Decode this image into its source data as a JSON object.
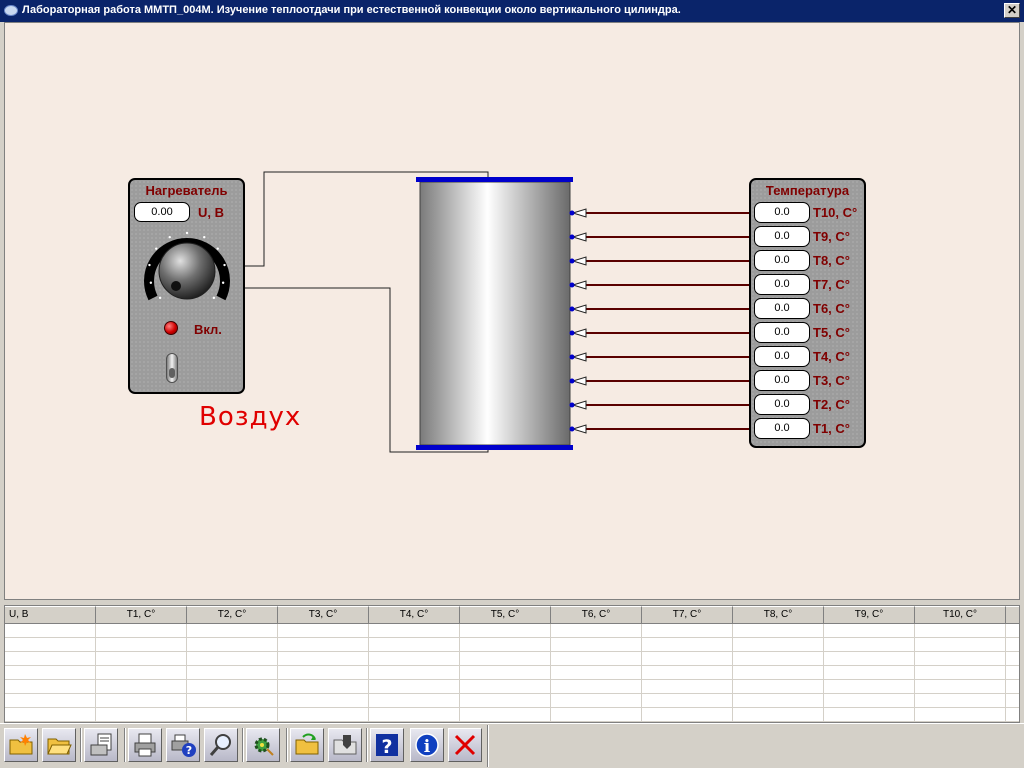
{
  "window": {
    "title": "Лабораторная работа ММТП_004М. Изучение теплоотдачи при естественной конвекции около вертикального цилиндра.",
    "close_label": "✕"
  },
  "heater": {
    "title": "Нагреватель",
    "voltage_value": "0.00",
    "voltage_label": "U, B",
    "power_label": "Вкл.",
    "led_color": "#d00000"
  },
  "environment_label": "Воздух",
  "temperature_panel": {
    "title": "Температура",
    "sensors": [
      {
        "label": "T10, C°",
        "value": "0.0"
      },
      {
        "label": "T9, C°",
        "value": "0.0"
      },
      {
        "label": "T8, C°",
        "value": "0.0"
      },
      {
        "label": "T7, C°",
        "value": "0.0"
      },
      {
        "label": "T6, C°",
        "value": "0.0"
      },
      {
        "label": "T5, C°",
        "value": "0.0"
      },
      {
        "label": "T4, C°",
        "value": "0.0"
      },
      {
        "label": "T3, C°",
        "value": "0.0"
      },
      {
        "label": "T2, C°",
        "value": "0.0"
      },
      {
        "label": "T1, C°",
        "value": "0.0"
      }
    ]
  },
  "table": {
    "columns": [
      "U, B",
      "T1, C°",
      "T2, C°",
      "T3, C°",
      "T4, C°",
      "T5, C°",
      "T6, C°",
      "T7, C°",
      "T8, C°",
      "T9, C°",
      "T10, C°"
    ],
    "rows": []
  },
  "toolbar": {
    "buttons": [
      {
        "name": "new-file-button",
        "icon": "new-folder-icon"
      },
      {
        "name": "open-file-button",
        "icon": "open-folder-icon"
      },
      {
        "name": "export-button",
        "icon": "export-document-icon"
      },
      {
        "name": "print-button",
        "icon": "printer-icon"
      },
      {
        "name": "print-help-button",
        "icon": "printer-help-icon"
      },
      {
        "name": "zoom-button",
        "icon": "magnifier-icon"
      },
      {
        "name": "settings-button",
        "icon": "gear-icon"
      },
      {
        "name": "open-data-button",
        "icon": "folder-arrow-icon"
      },
      {
        "name": "save-data-button",
        "icon": "folder-save-icon"
      },
      {
        "name": "help-button",
        "icon": "question-icon"
      },
      {
        "name": "info-button",
        "icon": "info-icon"
      },
      {
        "name": "exit-button",
        "icon": "red-cross-icon"
      }
    ]
  },
  "colors": {
    "workspace_bg": "#f6ebe3",
    "panel_label": "#800000",
    "environment_label": "#e00000",
    "cylinder_cap": "#0000cc",
    "thermocouple_wire": "#5a0000"
  }
}
